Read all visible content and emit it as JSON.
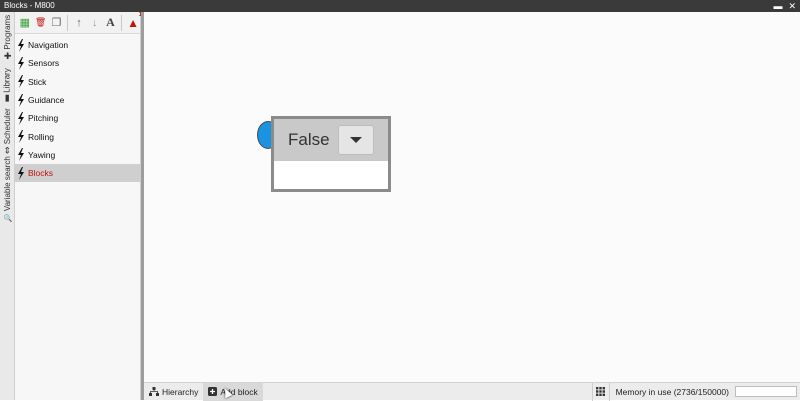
{
  "window": {
    "title": "Blocks - M800",
    "minimize_glyph": "▬",
    "close_glyph": "✕"
  },
  "vertical_tabs": [
    {
      "label": "Programs",
      "icon": "plus-icon",
      "glyph": "✚"
    },
    {
      "label": "Library",
      "icon": "book-icon",
      "glyph": "▮"
    },
    {
      "label": "Scheduler",
      "icon": "arrows-icon",
      "glyph": "⇕"
    },
    {
      "label": "Variable search",
      "icon": "search-icon",
      "glyph": "🔍"
    }
  ],
  "toolbar": {
    "buttons": [
      {
        "name": "add-grid-button",
        "icon": "grid-add-icon",
        "glyph": "▦",
        "color": "#3aa03a"
      },
      {
        "name": "delete-button",
        "icon": "trash-icon",
        "glyph": "🗑",
        "color": "#c0140e"
      },
      {
        "name": "copy-button",
        "icon": "copy-icon",
        "glyph": "❐",
        "color": "#666666"
      },
      {
        "name": "move-up-button",
        "icon": "arrow-up-icon",
        "glyph": "↑",
        "color": "#666666"
      },
      {
        "name": "move-down-button",
        "icon": "arrow-down-icon",
        "glyph": "↓",
        "color": "#9a9a9a"
      },
      {
        "name": "font-button",
        "icon": "font-icon",
        "glyph": "A",
        "color": "#444444"
      },
      {
        "name": "warnings-button",
        "icon": "warning-icon",
        "glyph": "▲",
        "color": "#c0140e",
        "badge": "1"
      }
    ]
  },
  "tree": {
    "items": [
      {
        "label": "Navigation"
      },
      {
        "label": "Sensors"
      },
      {
        "label": "Stick"
      },
      {
        "label": "Guidance"
      },
      {
        "label": "Pitching"
      },
      {
        "label": "Rolling"
      },
      {
        "label": "Yawing"
      },
      {
        "label": "Blocks",
        "selected": true
      }
    ]
  },
  "canvas": {
    "block": {
      "value": "False"
    }
  },
  "statusbar": {
    "hierarchy_label": "Hierarchy",
    "add_block_label": "Add block",
    "memory_label": "Memory in use (2736/150000)"
  },
  "colors": {
    "accent_blue": "#1b93e0",
    "selected_text": "#c0140e"
  }
}
